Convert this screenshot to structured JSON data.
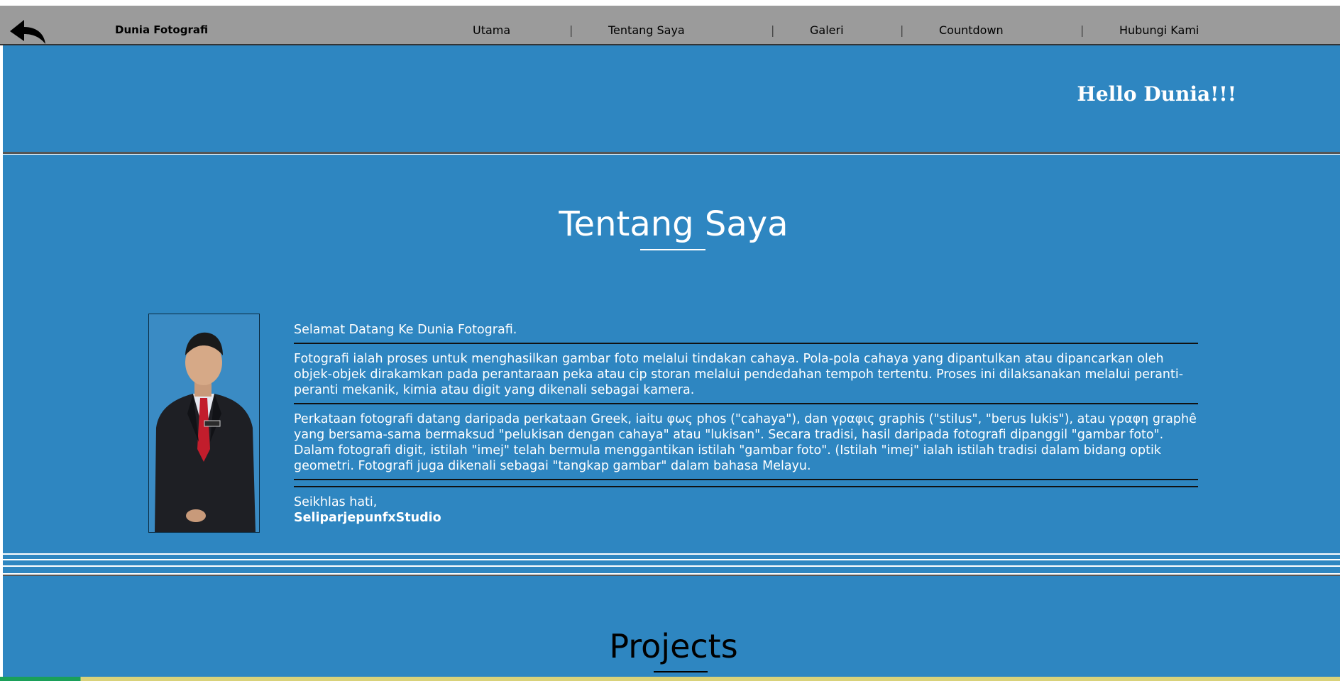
{
  "header": {
    "brand": "Dunia Fotografi",
    "nav": [
      {
        "label": "Utama"
      },
      {
        "label": "Tentang Saya"
      },
      {
        "label": "Galeri"
      },
      {
        "label": "Countdown"
      },
      {
        "label": "Hubungi Kami"
      }
    ],
    "separator": "|"
  },
  "hero": {
    "greeting": "Hello Dunia!!!"
  },
  "about": {
    "title": "Tentang Saya",
    "welcome": "Selamat Datang Ke Dunia Fotografi.",
    "paragraph1": "Fotografi ialah proses untuk menghasilkan gambar foto melalui tindakan cahaya. Pola-pola cahaya yang dipantulkan atau dipancarkan oleh objek-objek dirakamkan pada perantaraan peka atau cip storan melalui pendedahan tempoh tertentu. Proses ini dilaksanakan melalui peranti-peranti mekanik, kimia atau digit yang dikenali sebagai kamera.",
    "paragraph2": "Perkataan fotografi datang daripada perkataan Greek, iaitu φως phos (\"cahaya\"), dan γραφις graphis (\"stilus\", \"berus lukis\"), atau γραφη graphê yang bersama-sama bermaksud \"pelukisan dengan cahaya\" atau \"lukisan\". Secara tradisi, hasil daripada fotografi dipanggil \"gambar foto\". Dalam fotografi digit, istilah \"imej\" telah bermula menggantikan istilah \"gambar foto\". (Istilah \"imej\" ialah istilah tradisi dalam bidang optik geometri. Fotografi juga dikenali sebagai \"tangkap gambar\" dalam bahasa Melayu.",
    "closing": "Seikhlas hati,",
    "signature": "SeliparjepunfxStudio"
  },
  "projects": {
    "title": "Projects"
  },
  "colors": {
    "topbar": "#9b9b9b",
    "section_blue": "#2e86c1",
    "text_light": "#ffffff"
  },
  "icons": {
    "back": "back-arrow-icon"
  }
}
